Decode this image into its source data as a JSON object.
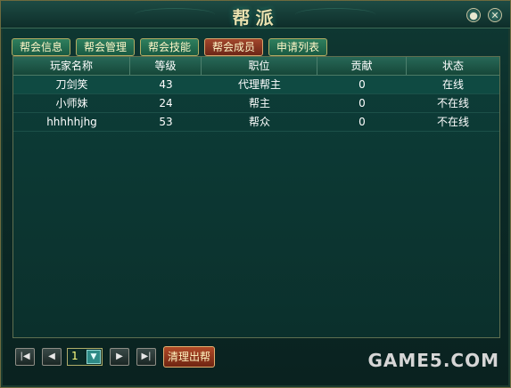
{
  "window": {
    "title": "帮派"
  },
  "tabs": [
    {
      "label": "帮会信息",
      "active": false
    },
    {
      "label": "帮会管理",
      "active": false
    },
    {
      "label": "帮会技能",
      "active": false
    },
    {
      "label": "帮会成员",
      "active": true
    },
    {
      "label": "申请列表",
      "active": false
    }
  ],
  "table": {
    "headers": [
      "玩家名称",
      "等级",
      "职位",
      "贡献",
      "状态"
    ],
    "rows": [
      {
        "name": "刀剑笑",
        "level": "43",
        "position": "代理帮主",
        "contribution": "0",
        "status": "在线"
      },
      {
        "name": "小师妹",
        "level": "24",
        "position": "帮主",
        "contribution": "0",
        "status": "不在线"
      },
      {
        "name": "hhhhhjhg",
        "level": "53",
        "position": "帮众",
        "contribution": "0",
        "status": "不在线"
      }
    ]
  },
  "pager": {
    "current_page": "1"
  },
  "buttons": {
    "clear_out": "清理出帮"
  },
  "watermark": "GAME5.COM",
  "icons": {
    "close": "close-icon",
    "help": "help-icon"
  }
}
